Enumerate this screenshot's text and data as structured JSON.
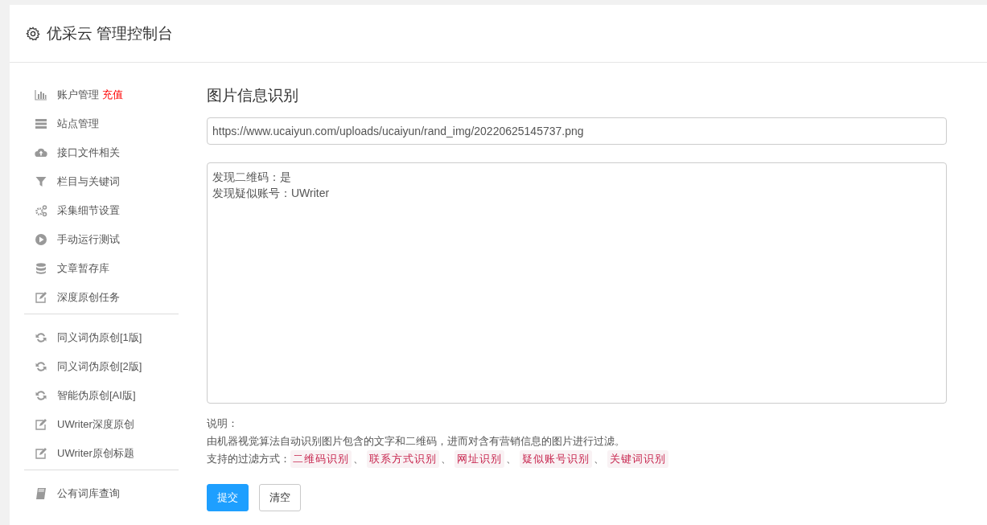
{
  "header": {
    "title": "优采云 管理控制台"
  },
  "sidebar": {
    "groups": [
      {
        "items": [
          {
            "label": "账户管理",
            "badge": "充值"
          },
          {
            "label": "站点管理"
          },
          {
            "label": "接口文件相关"
          },
          {
            "label": "栏目与关键词"
          },
          {
            "label": "采集细节设置"
          },
          {
            "label": "手动运行测试"
          },
          {
            "label": "文章暂存库"
          },
          {
            "label": "深度原创任务"
          }
        ]
      },
      {
        "items": [
          {
            "label": "同义词伪原创[1版]"
          },
          {
            "label": "同义词伪原创[2版]"
          },
          {
            "label": "智能伪原创[AI版]"
          },
          {
            "label": "UWriter深度原创"
          },
          {
            "label": "UWriter原创标题"
          }
        ]
      },
      {
        "items": [
          {
            "label": "公有词库查询"
          }
        ]
      }
    ]
  },
  "main": {
    "heading": "图片信息识别",
    "url_field": {
      "value": "https://www.ucaiyun.com/uploads/ucaiyun/rand_img/20220625145737.png"
    },
    "result_box": {
      "lines": [
        "发现二维码：是",
        "发现疑似账号：UWriter"
      ]
    },
    "notes": {
      "label": "说明：",
      "description": "由机器视觉算法自动识别图片包含的文字和二维码，进而对含有营销信息的图片进行过滤。",
      "filters_label": "支持的过滤方式：",
      "separator": "、",
      "filters": [
        "二维码识别",
        "联系方式识别",
        "网址识别",
        "疑似账号识别",
        "关键词识别"
      ]
    },
    "buttons": [
      {
        "label": "提交",
        "kind": "primary"
      },
      {
        "label": "清空",
        "kind": "default"
      }
    ]
  }
}
